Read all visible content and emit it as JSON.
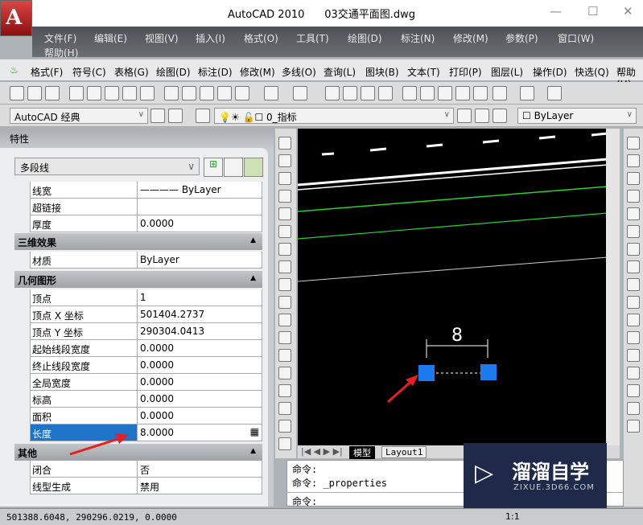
{
  "titlebar": {
    "app": "AutoCAD 2010",
    "file": "03交通平面图.dwg",
    "logo": "A"
  },
  "menubar": [
    "文件(F)",
    "编辑(E)",
    "视图(V)",
    "插入(I)",
    "格式(O)",
    "工具(T)",
    "绘图(D)",
    "标注(N)",
    "修改(M)",
    "参数(P)",
    "窗口(W)",
    "帮助(H)"
  ],
  "toolbar_menu": [
    "格式(F)",
    "符号(C)",
    "表格(G)",
    "绘图(D)",
    "标注(D)",
    "修改(M)",
    "多线(O)",
    "查询(L)",
    "图块(B)",
    "文本(T)",
    "打印(P)",
    "图层(L)",
    "操作(D)",
    "快选(Q)",
    "帮助(H)"
  ],
  "workspace": "AutoCAD 经典",
  "layer": "0_指标",
  "color": "ByLayer",
  "properties": {
    "title": "特性",
    "object_type": "多段线",
    "rows_top": [
      {
        "k": "线宽",
        "v": "ByLayer"
      },
      {
        "k": "超链接",
        "v": ""
      },
      {
        "k": "厚度",
        "v": "0.0000"
      }
    ],
    "sec3d": "三维效果",
    "rows_3d": [
      {
        "k": "材质",
        "v": "ByLayer"
      }
    ],
    "secgeo": "几何图形",
    "rows_geo": [
      {
        "k": "顶点",
        "v": "1"
      },
      {
        "k": "顶点 X 坐标",
        "v": "501404.2737"
      },
      {
        "k": "顶点 Y 坐标",
        "v": "290304.0413"
      },
      {
        "k": "起始线段宽度",
        "v": "0.0000"
      },
      {
        "k": "终止线段宽度",
        "v": "0.0000"
      },
      {
        "k": "全局宽度",
        "v": "0.0000"
      },
      {
        "k": "标高",
        "v": "0.0000"
      },
      {
        "k": "面积",
        "v": "0.0000"
      },
      {
        "k": "长度",
        "v": "8.0000"
      }
    ],
    "secother": "其他",
    "rows_other": [
      {
        "k": "闭合",
        "v": "否"
      },
      {
        "k": "线型生成",
        "v": "禁用"
      }
    ]
  },
  "canvas": {
    "dimension": "8"
  },
  "tabs": [
    "模型",
    "Layout1"
  ],
  "command": [
    "命令:",
    "命令: _properties",
    "命令:"
  ],
  "status": {
    "coords": "501388.6048, 290296.0219, 0.0000",
    "scale": "1:1"
  },
  "watermark": {
    "name": "溜溜自学",
    "url": "ZIXUE.3D66.COM"
  },
  "colors": {
    "selection": "#1e74c8",
    "grip": "#1a7cf0"
  }
}
